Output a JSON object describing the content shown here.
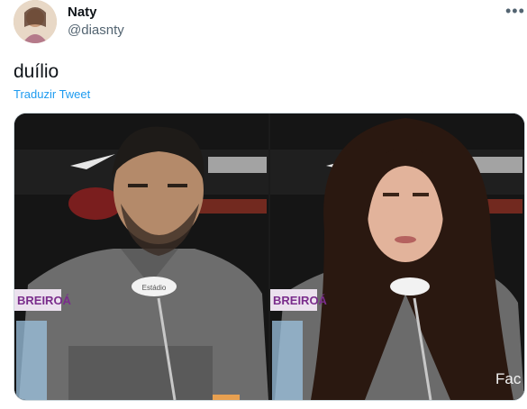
{
  "tweet": {
    "author_name": "Naty",
    "author_handle": "@diasnty",
    "more_icon": "more-icon",
    "text": "duílio",
    "translate_label": "Traduzir Tweet"
  },
  "media": {
    "left": {
      "sponsor_text": "BREIROÁ",
      "mic_text": "Estádio"
    },
    "right": {
      "sponsor_text": "BREIROÁ",
      "watermark": "Fac"
    }
  },
  "colors": {
    "link": "#1d9bf0",
    "text": "#0f1419",
    "secondary": "#536471"
  }
}
